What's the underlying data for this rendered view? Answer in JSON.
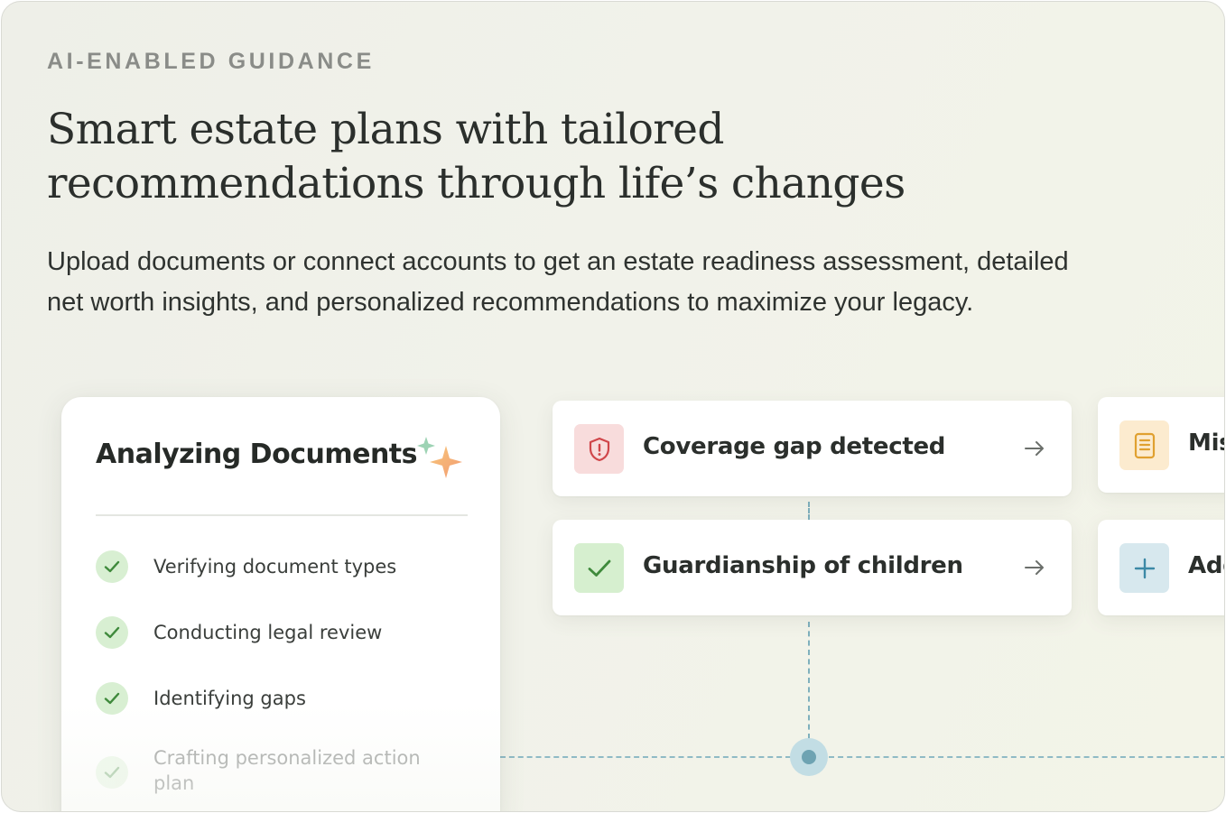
{
  "header": {
    "eyebrow": "AI-ENABLED GUIDANCE",
    "headline_line1": "Smart estate plans with tailored",
    "headline_line2": "recommendations through life’s changes",
    "subtext_line1": "Upload documents or connect accounts to get an estate readiness assessment, detailed",
    "subtext_line2": "net worth insights, and personalized recommendations to maximize your legacy."
  },
  "analysis": {
    "title": "Analyzing Documents",
    "icon": "sparkle-icon",
    "steps": [
      {
        "label": "Verifying document types",
        "status": "complete"
      },
      {
        "label": "Conducting legal review",
        "status": "complete"
      },
      {
        "label": "Identifying gaps",
        "status": "complete"
      },
      {
        "label": "Crafting personalized action plan",
        "status": "in-progress"
      }
    ]
  },
  "recommendations": [
    {
      "label": "Coverage gap detected",
      "icon": "shield-alert-icon",
      "icon_bg": "#f8dcdc",
      "icon_color": "#d0464a"
    },
    {
      "label": "Guardianship of children",
      "icon": "check-icon",
      "icon_bg": "#d6efcf",
      "icon_color": "#3f8a3c"
    },
    {
      "label": "Mis",
      "icon": "document-icon",
      "icon_bg": "#fcebcf",
      "icon_color": "#e0a030"
    },
    {
      "label": "Add",
      "icon": "plus-icon",
      "icon_bg": "#d7e8ee",
      "icon_color": "#3c89a6"
    }
  ],
  "colors": {
    "connector": "#7fb0bd",
    "check_bg": "#d8efd2",
    "check_mark": "#3f8a3c"
  }
}
